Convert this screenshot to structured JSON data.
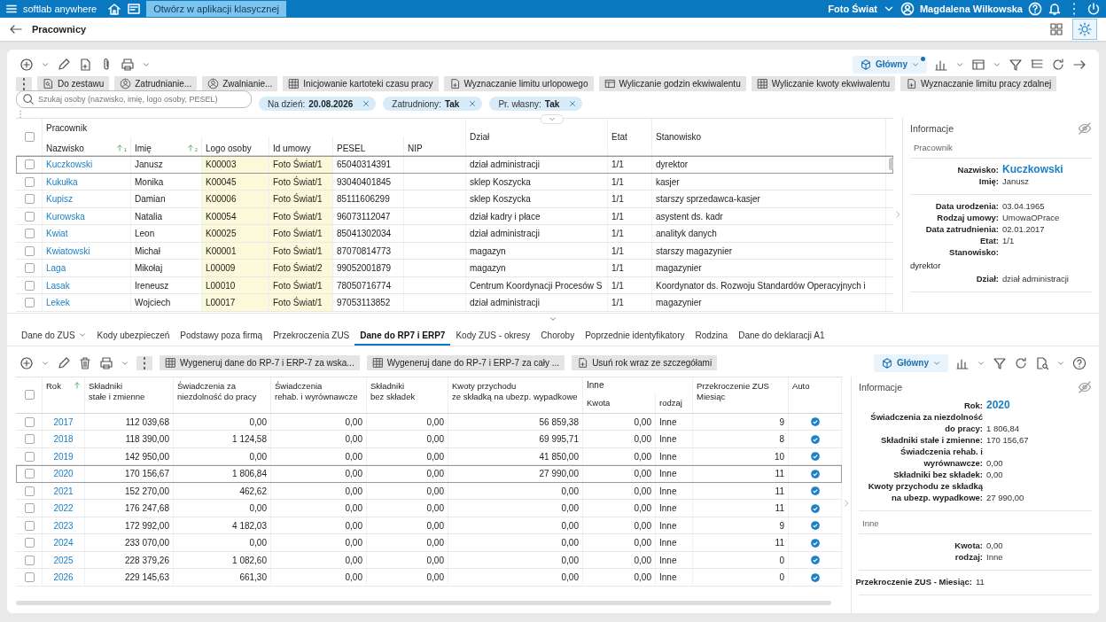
{
  "topbar": {
    "app_name": "softlab anywhere",
    "open_classic": "Otwórz w aplikacji klasycznej",
    "company": "Foto Świat",
    "user": "Magdalena Wilkowska"
  },
  "page": {
    "title": "Pracownicy"
  },
  "toolbar": {
    "view": "Główny"
  },
  "actions": [
    "Do zestawu",
    "Zatrudnianie...",
    "Zwalnianie...",
    "Inicjowanie kartoteki czasu pracy",
    "Wyznaczanie limitu urlopowego",
    "Wyliczanie godzin ekwiwalentu",
    "Wyliczanie kwoty ekwiwalentu",
    "Wyznaczanie limitu pracy zdalnej"
  ],
  "search": {
    "placeholder": "Szukaj osoby (nazwisko, imię, logo osoby, PESEL)"
  },
  "filters": [
    {
      "label": "Na dzień:",
      "value": "20.08.2026"
    },
    {
      "label": "Zatrudniony:",
      "value": "Tak"
    },
    {
      "label": "Pr. własny:",
      "value": "Tak"
    }
  ],
  "employees": {
    "group_label": "Pracownik",
    "all_checked": false,
    "columns": [
      {
        "label": "Nazwisko",
        "grouped": true,
        "kind": "link",
        "sorted": true,
        "sort_index": "1"
      },
      {
        "label": "Imię",
        "grouped": true,
        "kind": "text",
        "sorted": true,
        "sort_index": "2"
      },
      {
        "label": "Logo osoby",
        "grouped": true,
        "kind": "highlight",
        "sorted": false
      },
      {
        "label": "Id umowy",
        "grouped": true,
        "kind": "highlight",
        "sorted": false
      },
      {
        "label": "PESEL",
        "grouped": true,
        "kind": "text",
        "sorted": false
      },
      {
        "label": "NIP",
        "grouped": true,
        "kind": "text",
        "sorted": false
      },
      {
        "label": "Dział",
        "grouped": false,
        "kind": "text",
        "sorted": false
      },
      {
        "label": "Etat",
        "grouped": false,
        "kind": "text",
        "sorted": false
      },
      {
        "label": "Stanowisko",
        "grouped": false,
        "kind": "text",
        "sorted": false
      }
    ],
    "rows": [
      {
        "selected": true,
        "checked": false,
        "cells": [
          "Kuczkowski",
          "Janusz",
          "K00003",
          "Foto Świat/1",
          "65040314391",
          "",
          "dział administracji",
          "1/1",
          "dyrektor"
        ]
      },
      {
        "selected": false,
        "checked": false,
        "cells": [
          "Kukułka",
          "Monika",
          "K00045",
          "Foto Świat/1",
          "93040401845",
          "",
          "sklep Koszycka",
          "1/1",
          "kasjer"
        ]
      },
      {
        "selected": false,
        "checked": false,
        "cells": [
          "Kupisz",
          "Damian",
          "K00006",
          "Foto Świat/1",
          "85111606299",
          "",
          "sklep Koszycka",
          "1/1",
          "starszy sprzedawca-kasjer"
        ]
      },
      {
        "selected": false,
        "checked": false,
        "cells": [
          "Kurowska",
          "Natalia",
          "K00054",
          "Foto Świat/1",
          "96073112047",
          "",
          "dział kadry i płace",
          "1/1",
          "asystent ds. kadr"
        ]
      },
      {
        "selected": false,
        "checked": false,
        "cells": [
          "Kwiat",
          "Leon",
          "K00025",
          "Foto Świat/1",
          "85041302034",
          "",
          "dział administracji",
          "1/1",
          "analityk danych"
        ]
      },
      {
        "selected": false,
        "checked": false,
        "cells": [
          "Kwiatowski",
          "Michał",
          "K00001",
          "Foto Świat/1",
          "87070814773",
          "",
          "magazyn",
          "1/1",
          "starszy magazynier"
        ]
      },
      {
        "selected": false,
        "checked": false,
        "cells": [
          "Laga",
          "Mikołaj",
          "L00009",
          "Foto Świat/2",
          "99052001879",
          "",
          "magazyn",
          "1/1",
          "magazynier"
        ]
      },
      {
        "selected": false,
        "checked": false,
        "cells": [
          "Lasak",
          "Ireneusz",
          "L00010",
          "Foto Świat/1",
          "78050716774",
          "",
          "Centrum Koordynacji Procesów S",
          "1/1",
          "Koordynator ds. Rozwoju Standardów Operacyjnych i"
        ]
      },
      {
        "selected": false,
        "checked": false,
        "cells": [
          "Lekek",
          "Wojciech",
          "L00017",
          "Foto Świat/1",
          "97053113852",
          "",
          "dział administracji",
          "1/1",
          "magazynier"
        ]
      }
    ]
  },
  "employee_info": {
    "title": "Informacje",
    "section": "Pracownik",
    "groups": [
      [
        {
          "label": "Nazwisko:",
          "value": "Kuczkowski",
          "kind": "title"
        },
        {
          "label": "Imię:",
          "value": "Janusz",
          "kind": "plain"
        }
      ],
      [
        {
          "label": "Data urodzenia:",
          "value": "03.04.1965",
          "kind": "plain"
        },
        {
          "label": "Rodzaj umowy:",
          "value": "UmowaOPrace",
          "kind": "plain"
        },
        {
          "label": "Data zatrudnienia:",
          "value": "02.01.2017",
          "kind": "plain"
        },
        {
          "label": "Etat:",
          "value": "1/1",
          "kind": "plain"
        },
        {
          "label": "Stanowisko:",
          "value": "dyrektor",
          "kind": "block"
        },
        {
          "label": "Dział:",
          "value": "dział administracji",
          "kind": "plain"
        }
      ]
    ]
  },
  "tabs": [
    {
      "label": "Dane do ZUS",
      "selected": false,
      "dropdown": true
    },
    {
      "label": "Kody ubezpieczeń",
      "selected": false,
      "dropdown": false
    },
    {
      "label": "Podstawy poza firmą",
      "selected": false,
      "dropdown": false
    },
    {
      "label": "Przekroczenia ZUS",
      "selected": false,
      "dropdown": false
    },
    {
      "label": "Dane do RP7 i ERP7",
      "selected": true,
      "dropdown": false
    },
    {
      "label": "Kody ZUS - okresy",
      "selected": false,
      "dropdown": false
    },
    {
      "label": "Choroby",
      "selected": false,
      "dropdown": false
    },
    {
      "label": "Poprzednie identyfikatory",
      "selected": false,
      "dropdown": false
    },
    {
      "label": "Rodzina",
      "selected": false,
      "dropdown": false
    },
    {
      "label": "Dane do deklaracji A1",
      "selected": false,
      "dropdown": false
    }
  ],
  "detail_actions": [
    "Wygeneruj dane do RP-7 i ERP-7 za wska...",
    "Wygeneruj dane do RP-7 i ERP-7 za cały ...",
    "Usuń rok wraz ze szczegółami"
  ],
  "detail_toolbar": {
    "view": "Główny"
  },
  "zus": {
    "group_label": "Inne",
    "all_checked": false,
    "columns": [
      {
        "label": "Rok",
        "grouped": false,
        "kind": "link",
        "sorted": true
      },
      {
        "label": "Składniki\nstałe i zmienne",
        "grouped": false,
        "kind": "number",
        "sorted": false
      },
      {
        "label": "Świadczenia za\nniezdolność do pracy",
        "grouped": false,
        "kind": "number",
        "sorted": false
      },
      {
        "label": "Świadczenia\nrehab. i wyrównawcze",
        "grouped": false,
        "kind": "number",
        "sorted": false
      },
      {
        "label": "Składniki\nbez składek",
        "grouped": false,
        "kind": "number",
        "sorted": false
      },
      {
        "label": "Kwoty przychodu\nze składką na ubezp. wypadkowe",
        "grouped": false,
        "kind": "number",
        "sorted": false
      },
      {
        "label": "Kwota",
        "grouped": true,
        "kind": "number",
        "sorted": false
      },
      {
        "label": "rodzaj",
        "grouped": true,
        "kind": "text",
        "sorted": false
      },
      {
        "label": "Przekroczenie ZUS\nMiesiąc",
        "grouped": false,
        "kind": "number",
        "sorted": false
      },
      {
        "label": "Auto",
        "grouped": false,
        "kind": "check",
        "sorted": false
      }
    ],
    "rows": [
      {
        "selected": false,
        "checked": false,
        "auto": true,
        "cells": [
          "2017",
          "112 039,68",
          "0,00",
          "0,00",
          "0,00",
          "56 859,38",
          "0,00",
          "Inne",
          "9"
        ]
      },
      {
        "selected": false,
        "checked": false,
        "auto": true,
        "cells": [
          "2018",
          "118 390,00",
          "1 124,58",
          "0,00",
          "0,00",
          "69 995,71",
          "0,00",
          "Inne",
          "8"
        ]
      },
      {
        "selected": false,
        "checked": false,
        "auto": true,
        "cells": [
          "2019",
          "142 950,00",
          "0,00",
          "0,00",
          "0,00",
          "41 850,00",
          "0,00",
          "Inne",
          "10"
        ]
      },
      {
        "selected": true,
        "checked": false,
        "auto": true,
        "cells": [
          "2020",
          "170 156,67",
          "1 806,84",
          "0,00",
          "0,00",
          "27 990,00",
          "0,00",
          "Inne",
          "11"
        ]
      },
      {
        "selected": false,
        "checked": false,
        "auto": true,
        "cells": [
          "2021",
          "152 270,00",
          "462,62",
          "0,00",
          "0,00",
          "0,00",
          "0,00",
          "Inne",
          "11"
        ]
      },
      {
        "selected": false,
        "checked": false,
        "auto": true,
        "cells": [
          "2022",
          "176 247,68",
          "0,00",
          "0,00",
          "0,00",
          "0,00",
          "0,00",
          "Inne",
          "11"
        ]
      },
      {
        "selected": false,
        "checked": false,
        "auto": true,
        "cells": [
          "2023",
          "172 992,00",
          "4 182,03",
          "0,00",
          "0,00",
          "0,00",
          "0,00",
          "Inne",
          "9"
        ]
      },
      {
        "selected": false,
        "checked": false,
        "auto": true,
        "cells": [
          "2024",
          "233 070,00",
          "0,00",
          "0,00",
          "0,00",
          "0,00",
          "0,00",
          "Inne",
          "11"
        ]
      },
      {
        "selected": false,
        "checked": false,
        "auto": true,
        "cells": [
          "2025",
          "228 379,26",
          "1 082,60",
          "0,00",
          "0,00",
          "0,00",
          "0,00",
          "Inne",
          "0"
        ]
      },
      {
        "selected": false,
        "checked": false,
        "auto": true,
        "cells": [
          "2026",
          "229 145,63",
          "661,30",
          "0,00",
          "0,00",
          "0,00",
          "0,00",
          "Inne",
          "0"
        ]
      }
    ]
  },
  "zus_info": {
    "title": "Informacje",
    "groups": [
      {
        "fields": [
          {
            "label": "Rok:",
            "value": "2020",
            "kind": "title"
          },
          {
            "label": "Świadczenia za niezdolność do pracy:",
            "value": "1 806,84",
            "kind": "plain"
          },
          {
            "label": "Składniki stałe i zmienne:",
            "value": "170 156,67",
            "kind": "plain"
          },
          {
            "label": "Świadczenia rehab. i wyrównawcze:",
            "value": "0,00",
            "kind": "plain"
          },
          {
            "label": "Składniki bez składek:",
            "value": "0,00",
            "kind": "plain"
          },
          {
            "label": "Kwoty przychodu ze składką na ubezp. wypadkowe:",
            "value": "27 990,00",
            "kind": "plain"
          }
        ]
      },
      {
        "heading": "Inne",
        "fields": [
          {
            "label": "Kwota:",
            "value": "0,00",
            "kind": "plain"
          },
          {
            "label": "rodzaj:",
            "value": "Inne",
            "kind": "plain"
          }
        ]
      },
      {
        "fields": [
          {
            "label": "Przekroczenie ZUS - Miesiąc:",
            "value": "11",
            "kind": "wide"
          }
        ]
      }
    ]
  }
}
